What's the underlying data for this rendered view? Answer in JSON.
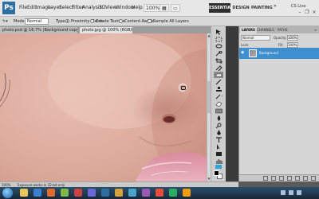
{
  "menubar": {
    "logo": "Ps",
    "items": [
      "File",
      "Edit",
      "Image",
      "Layer",
      "Select",
      "Filter",
      "Analysis",
      "3D",
      "View",
      "Window",
      "Help"
    ],
    "zoom_value": "100%",
    "workspace": [
      "ESSENTIALS",
      "DESIGN",
      "PAINTING"
    ],
    "cs_live": "CS Live"
  },
  "options": {
    "mode_label": "Mode:",
    "mode_value": "Normal",
    "type_label": "Type:",
    "proximity_match": "Proximity Match",
    "create_texture": "Create Texture",
    "content_aware": "Content-Aware",
    "sample_all_layers": "Sample All Layers"
  },
  "tabs": {
    "doc1": "photo.psd @ 16.7% (Background copy 2, RGB/8*) *",
    "doc2": "photo.jpg @ 100% (RGB/8*)"
  },
  "layers_panel": {
    "tabs": [
      "LAYERS",
      "CHANNELS",
      "PATHS"
    ],
    "blend_mode": "Normal",
    "opacity_label": "Opacity:",
    "opacity_value": "100%",
    "lock_label": "Lock:",
    "fill_label": "Fill:",
    "fill_value": "100%",
    "layer_name": "Background"
  },
  "status": {
    "zoom": "100%",
    "info": "Exposure works in 32-bit only"
  },
  "colors": {
    "accent": "#3d8fd0",
    "menubar": "#e7e7e7",
    "skin": "#d8a79a"
  }
}
